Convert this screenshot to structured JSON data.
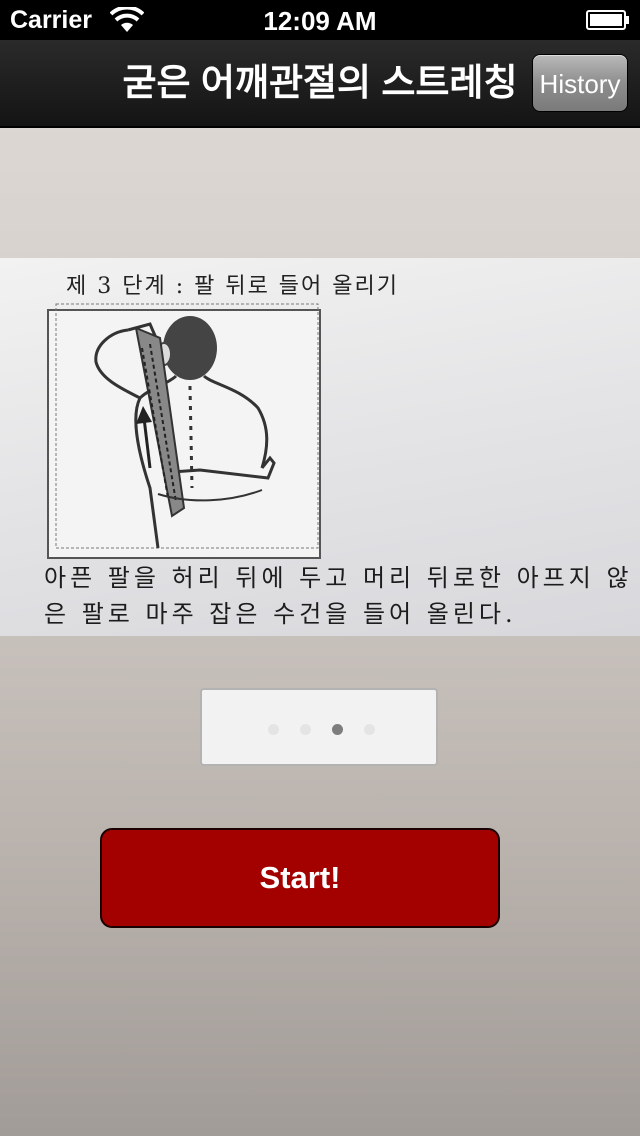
{
  "status_bar": {
    "carrier": "Carrier",
    "time": "12:09 AM"
  },
  "nav": {
    "title": "굳은 어깨관절의 스트레칭",
    "history_label": "History"
  },
  "photo": {
    "step_title": "제 3 단계 : 팔 뒤로 들어 올리기",
    "description": "아픈 팔을 허리 뒤에 두고 머리 뒤로한 아프지 않은 팔로 마주 잡은 수건을 들어 올린다."
  },
  "page_control": {
    "page_count": 4,
    "current_page": 3
  },
  "start_button": {
    "label": "Start!"
  },
  "colors": {
    "start_button": "#a30000",
    "nav_bar": "#1c1c1c"
  }
}
